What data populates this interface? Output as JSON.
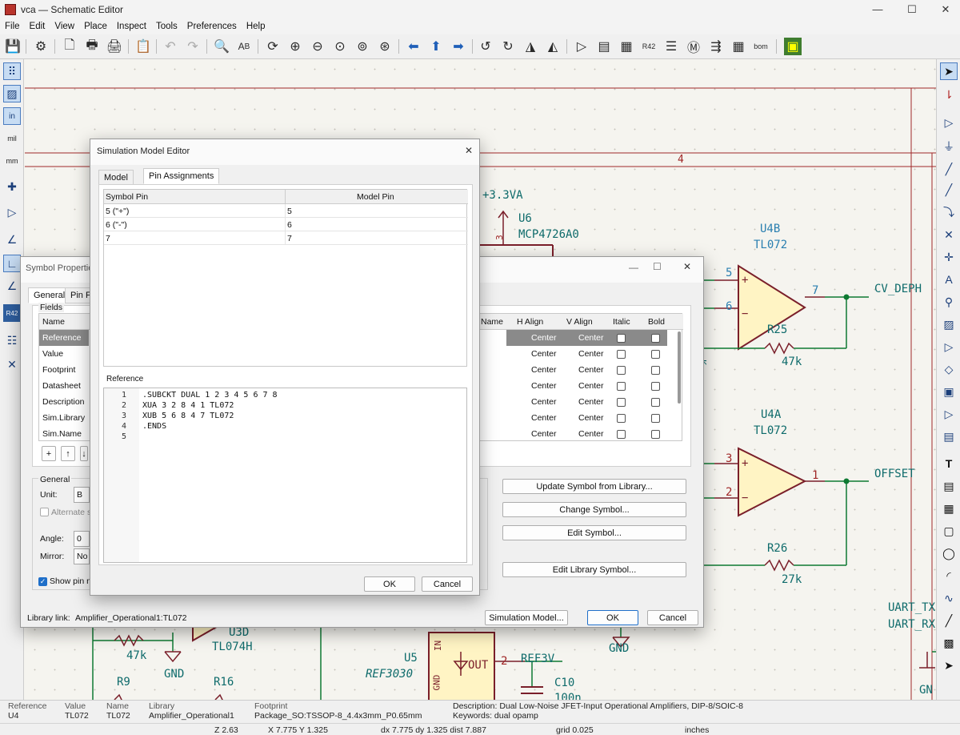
{
  "window": {
    "title": "vca — Schematic Editor",
    "min": "—",
    "max": "☐",
    "close": "✕"
  },
  "menu": [
    "File",
    "Edit",
    "View",
    "Place",
    "Inspect",
    "Tools",
    "Preferences",
    "Help"
  ],
  "schematic": {
    "sheet_zone": "4",
    "power_3v3": "+3.3VA",
    "u6_ref": "U6",
    "u6_val": "MCP4726A0",
    "u4b_ref": "U4B",
    "u4b_val": "TL072",
    "u4b_pin5": "5",
    "u4b_pin6": "6",
    "u4b_pin7": "7",
    "u4b_plus": "+",
    "u4b_minus": "−",
    "r25_ref": "R25",
    "r25_val": "47k",
    "cv_deph": "CV_DEPH",
    "u4a_ref": "U4A",
    "u4a_val": "TL072",
    "u4a_pin3": "3",
    "u4a_pin2": "2",
    "u4a_pin1": "1",
    "u4a_plus": "+",
    "u4a_minus": "−",
    "offset": "OFFSET",
    "r26_ref": "R26",
    "r26_val": "27k",
    "uart_tx": "UART_TX",
    "uart_rx": "UART_RX",
    "gnd1": "GND",
    "gnd2": "GND",
    "gnd3": "GN",
    "u3d_ref": "U3D",
    "u3d_val": "TL074H",
    "r_47k": "47k",
    "r9": "R9",
    "r16": "R16",
    "u5_ref": "U5",
    "u5_val": "REF3030",
    "u5_out": "OUT",
    "u5_gnd": "GND",
    "u5_in": "IN",
    "u5_pin2": "2",
    "ref3v": "REF3V",
    "c10": "C10",
    "c10_val": "100n",
    "u6_pin3": "3",
    "r25_k": "K"
  },
  "symbol_props": {
    "title": "Symbol Properties",
    "tabs": [
      "General",
      "Pin Fu"
    ],
    "fields_label": "Fields",
    "col_name": "Name",
    "col_name2": "Name",
    "col_halign": "H Align",
    "col_valign": "V Align",
    "col_italic": "Italic",
    "col_bold": "Bold",
    "rows": [
      "Reference",
      "Value",
      "Footprint",
      "Datasheet",
      "Description",
      "Sim.Library",
      "Sim.Name"
    ],
    "halign": "Center",
    "valign": "Center",
    "general_label": "General",
    "unit_label": "Unit:",
    "unit_val": "B",
    "alt_sym": "Alternate s",
    "angle_label": "Angle:",
    "angle_val": "0",
    "mirror_label": "Mirror:",
    "mirror_val": "No",
    "show_pin": "Show pin n",
    "btn_update": "Update Symbol from Library...",
    "btn_change": "Change Symbol...",
    "btn_edit": "Edit Symbol...",
    "btn_editlib": "Edit Library Symbol...",
    "lib_link_label": "Library link:",
    "lib_link": "Amplifier_Operational1:TL072",
    "btn_sim": "Simulation Model...",
    "btn_ok": "OK",
    "btn_cancel": "Cancel"
  },
  "sim_editor": {
    "title": "Simulation Model Editor",
    "tabs": [
      "Model",
      "Pin Assignments"
    ],
    "col_symbol_pin": "Symbol Pin",
    "col_model_pin": "Model Pin",
    "pins": [
      {
        "sym": "5 (\"+\")",
        "model": "5"
      },
      {
        "sym": "6 (\"-\")",
        "model": "6"
      },
      {
        "sym": "7",
        "model": "7"
      }
    ],
    "reference_label": "Reference",
    "code": [
      ".SUBCKT DUAL 1 2 3 4 5 6 7 8",
      "XUA 3 2 8 4 1 TL072",
      "XUB 5 6 8 4 7 TL072",
      ".ENDS",
      ""
    ],
    "line_nums": [
      "1",
      "2",
      "3",
      "4",
      "5"
    ],
    "btn_ok": "OK",
    "btn_cancel": "Cancel"
  },
  "status": {
    "reference_label": "Reference",
    "reference": "U4",
    "value_label": "Value",
    "value": "TL072",
    "name_label": "Name",
    "name": "TL072",
    "library_label": "Library",
    "library": "Amplifier_Operational1",
    "footprint_label": "Footprint",
    "footprint": "Package_SO:TSSOP-8_4.4x3mm_P0.65mm",
    "description": "Description: Dual Low-Noise JFET-Input Operational Amplifiers, DIP-8/SOIC-8",
    "keywords": "Keywords: dual opamp",
    "zoom": "Z 2.63",
    "xy": "X 7.775  Y 1.325",
    "dxy": "dx 7.775  dy 1.325  dist 7.887",
    "grid": "grid 0.025",
    "units": "inches"
  },
  "left_tools": {
    "mil": "mil",
    "mm": "mm",
    "in": "in"
  }
}
